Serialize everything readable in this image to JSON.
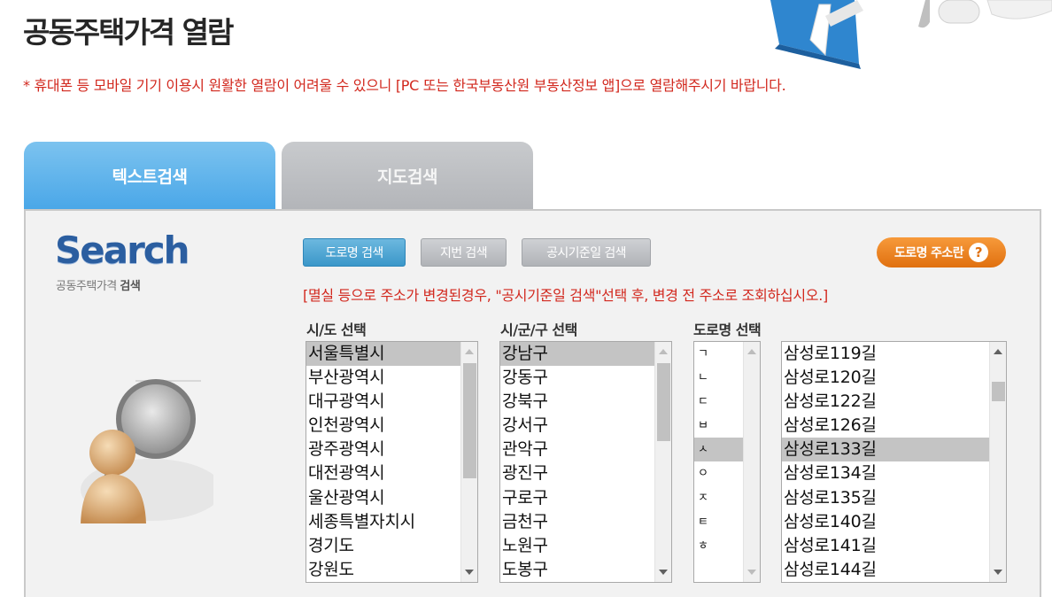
{
  "page": {
    "title": "공동주택가격 열람",
    "notice": "* 휴대폰 등 모바일 기기 이용시 원활한 열람이 어려울 수 있으니 [PC 또는 한국부동산원 부동산정보 앱]으로 열람해주시기 바랍니다."
  },
  "tabs": [
    {
      "label": "텍스트검색",
      "active": true
    },
    {
      "label": "지도검색",
      "active": false
    }
  ],
  "logo": {
    "title": "Search",
    "subtitle_a": "공동주택가격 ",
    "subtitle_b": "검색"
  },
  "buttons": {
    "road": "도로명 검색",
    "lot": "지번 검색",
    "date": "공시기준일 검색",
    "road_addr": "도로명 주소란",
    "help_icon": "?"
  },
  "warning": "[멸실 등으로 주소가 변경된경우, \"공시기준일 검색\"선택 후, 변경 전 주소로 조회하십시오.]",
  "lists": {
    "sido": {
      "label": "시/도 선택",
      "selected": "서울특별시",
      "options": [
        "서울특별시",
        "부산광역시",
        "대구광역시",
        "인천광역시",
        "광주광역시",
        "대전광역시",
        "울산광역시",
        "세종특별자치시",
        "경기도",
        "강원도"
      ]
    },
    "sigungu": {
      "label": "시/군/구 선택",
      "selected": "강남구",
      "options": [
        "강남구",
        "강동구",
        "강북구",
        "강서구",
        "관악구",
        "광진구",
        "구로구",
        "금천구",
        "노원구",
        "도봉구"
      ]
    },
    "initial": {
      "label": "도로명 선택",
      "selected": "ㅅ",
      "options": [
        "ㄱ",
        "ㄴ",
        "ㄷ",
        "ㅂ",
        "ㅅ",
        "ㅇ",
        "ㅈ",
        "ㅌ",
        "ㅎ"
      ]
    },
    "road": {
      "selected": "삼성로133길",
      "options": [
        "삼성로119길",
        "삼성로120길",
        "삼성로122길",
        "삼성로126길",
        "삼성로133길",
        "삼성로134길",
        "삼성로135길",
        "삼성로140길",
        "삼성로141길",
        "삼성로144길"
      ]
    }
  },
  "colors": {
    "tab_active": "#4aa7e8",
    "tab_inactive": "#b3b5b9",
    "accent_button": "#3b97c9",
    "orange_button": "#e0700f",
    "notice_text": "#d2281e",
    "logo_blue": "#2b5ea0"
  },
  "icons": [
    "hero-illustration",
    "magnifier-person-illustration",
    "help-icon",
    "scroll-up-arrow-icon",
    "scroll-down-arrow-icon"
  ]
}
